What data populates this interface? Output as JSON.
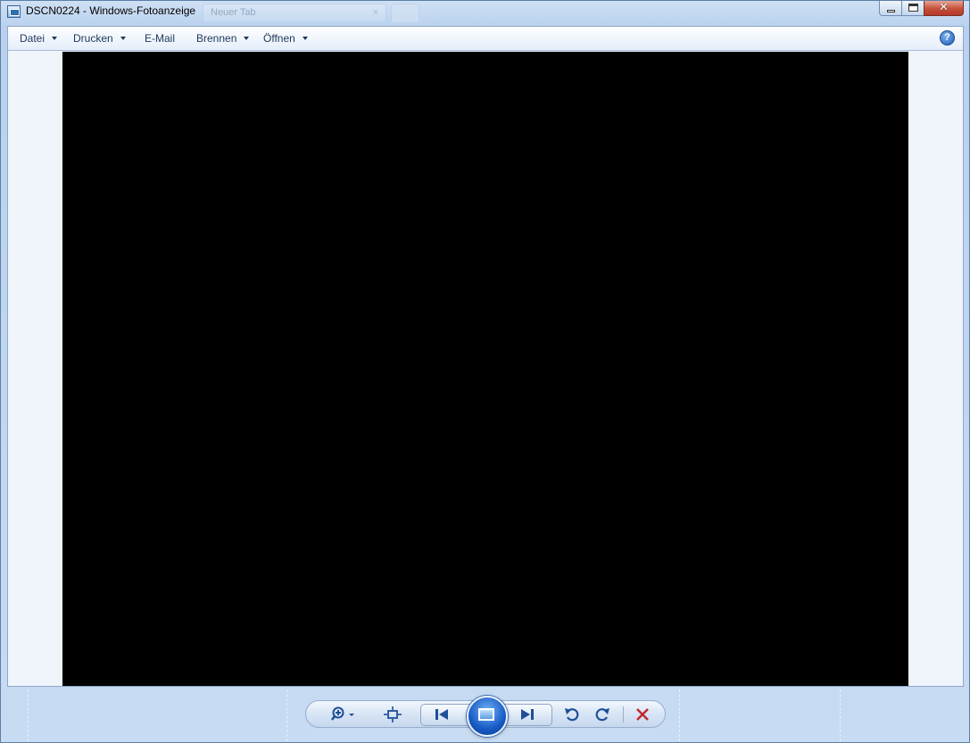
{
  "window": {
    "title": "DSCN0224 - Windows-Fotoanzeige",
    "ghost_tab_label": "Neuer Tab",
    "ghost_tab_close": "×",
    "caption_close": "✕"
  },
  "menu": {
    "items": [
      {
        "label": "Datei",
        "has_dropdown": true
      },
      {
        "label": "Drucken",
        "has_dropdown": true
      },
      {
        "label": "E-Mail",
        "has_dropdown": false
      },
      {
        "label": "Brennen",
        "has_dropdown": true
      },
      {
        "label": "Öffnen",
        "has_dropdown": true
      }
    ],
    "help_label": "?"
  },
  "viewer": {
    "image_background": "#000000"
  },
  "toolbar": {
    "zoom_icon": "zoom-icon",
    "fit_icon": "fit-to-window-icon",
    "previous_icon": "previous-icon",
    "slideshow_icon": "slideshow-icon",
    "next_icon": "next-icon",
    "rotate_left_icon": "rotate-counterclockwise-icon",
    "rotate_right_icon": "rotate-clockwise-icon",
    "delete_icon": "delete-icon",
    "delete_color": "#c0262b",
    "accent_color": "#1f4f96"
  }
}
